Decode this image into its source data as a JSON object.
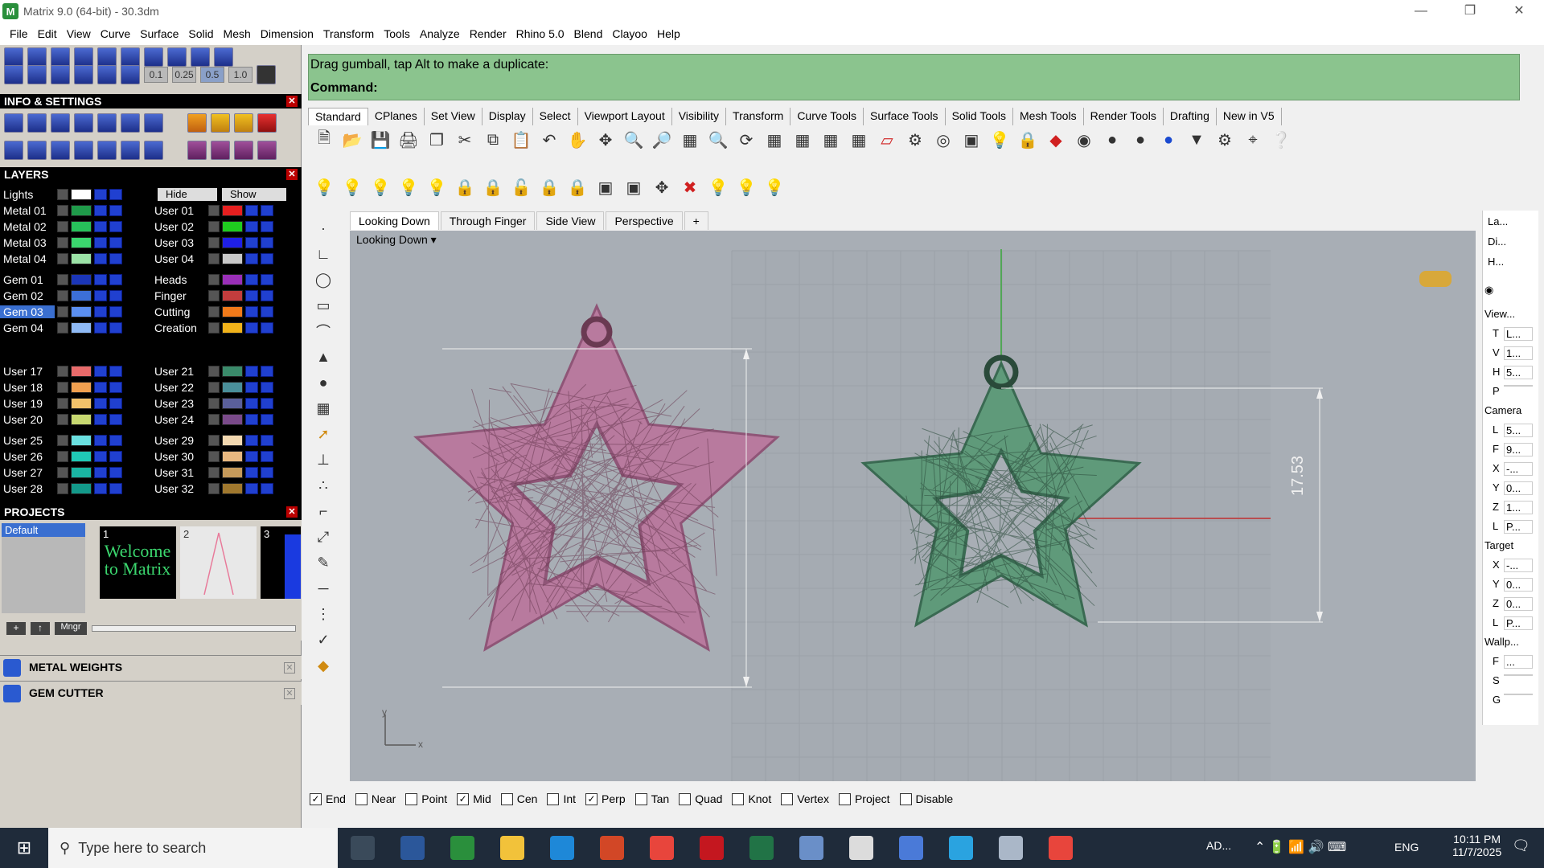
{
  "window": {
    "title": "Matrix 9.0 (64-bit) - 30.3dm"
  },
  "menu": [
    "File",
    "Edit",
    "View",
    "Curve",
    "Surface",
    "Solid",
    "Mesh",
    "Dimension",
    "Transform",
    "Tools",
    "Analyze",
    "Render",
    "Rhino 5.0",
    "Blend",
    "Clayoo",
    "Help"
  ],
  "left_toolbar": {
    "values": [
      "0.1",
      "0.25",
      "0.5",
      "1.0"
    ]
  },
  "info_settings": {
    "title": "INFO & SETTINGS"
  },
  "layers": {
    "title": "LAYERS",
    "lights": "Lights",
    "hide_label": "Hide",
    "show_label": "Show",
    "left_col": [
      {
        "name": "Metal 01",
        "color": "#1f9a4a"
      },
      {
        "name": "Metal 02",
        "color": "#27c05a"
      },
      {
        "name": "Metal 03",
        "color": "#3bd66e"
      },
      {
        "name": "Metal 04",
        "color": "#9be2a6"
      },
      {
        "name": "Gem 01",
        "color": "#1b36b8"
      },
      {
        "name": "Gem 02",
        "color": "#3c6fd7"
      },
      {
        "name": "Gem 03",
        "color": "#5b8ff0",
        "selected": true
      },
      {
        "name": "Gem 04",
        "color": "#8fbaf5"
      },
      {
        "name": "User 17",
        "color": "#e86b6b"
      },
      {
        "name": "User 18",
        "color": "#f0a050"
      },
      {
        "name": "User 19",
        "color": "#f2c26a"
      },
      {
        "name": "User 20",
        "color": "#c7d870"
      },
      {
        "name": "User 25",
        "color": "#6ae0e0"
      },
      {
        "name": "User 26",
        "color": "#20c9b5"
      },
      {
        "name": "User 27",
        "color": "#1ab5a3"
      },
      {
        "name": "User 28",
        "color": "#13998a"
      }
    ],
    "right_col": [
      {
        "name": "User 01",
        "color": "#e61f1f"
      },
      {
        "name": "User 02",
        "color": "#1fcc1f"
      },
      {
        "name": "User 03",
        "color": "#1f1fe6"
      },
      {
        "name": "User 04",
        "color": "#c8c8c8"
      },
      {
        "name": "Heads",
        "color": "#9a2fb8"
      },
      {
        "name": "Finger",
        "color": "#c33d3d"
      },
      {
        "name": "Cutting",
        "color": "#f07a1a"
      },
      {
        "name": "Creation",
        "color": "#f0b21a"
      },
      {
        "name": "User 21",
        "color": "#3a8a6a"
      },
      {
        "name": "User 22",
        "color": "#4a8f9a"
      },
      {
        "name": "User 23",
        "color": "#5a5f9a"
      },
      {
        "name": "User 24",
        "color": "#7a4a8a"
      },
      {
        "name": "User 29",
        "color": "#f2d8b0"
      },
      {
        "name": "User 30",
        "color": "#e8b880"
      },
      {
        "name": "User 31",
        "color": "#c69a5a"
      },
      {
        "name": "User 32",
        "color": "#a0782e"
      }
    ]
  },
  "projects": {
    "title": "PROJECTS",
    "items": [
      "Default"
    ],
    "thumbs": [
      {
        "num": "1",
        "text": "Welcome to Matrix"
      },
      {
        "num": "2",
        "text": ""
      },
      {
        "num": "3",
        "text": ""
      }
    ],
    "mngr": "Mngr"
  },
  "plugins": [
    {
      "name": "METAL WEIGHTS"
    },
    {
      "name": "GEM CUTTER"
    }
  ],
  "command": {
    "prompt": "Drag gumball, tap Alt to make a duplicate:",
    "label": "Command:"
  },
  "toolbar_tabs": [
    "Standard",
    "CPlanes",
    "Set View",
    "Display",
    "Select",
    "Viewport Layout",
    "Visibility",
    "Transform",
    "Curve Tools",
    "Surface Tools",
    "Solid Tools",
    "Mesh Tools",
    "Render Tools",
    "Drafting",
    "New in V5"
  ],
  "viewport_tabs": [
    "Looking Down",
    "Through Finger",
    "Side View",
    "Perspective"
  ],
  "viewport": {
    "label": "Looking Down",
    "dimension": "17.53",
    "axis_x": "x",
    "axis_y": "y"
  },
  "snaps": [
    {
      "label": "End",
      "checked": true
    },
    {
      "label": "Near",
      "checked": false
    },
    {
      "label": "Point",
      "checked": false
    },
    {
      "label": "Mid",
      "checked": true
    },
    {
      "label": "Cen",
      "checked": false
    },
    {
      "label": "Int",
      "checked": false
    },
    {
      "label": "Perp",
      "checked": true
    },
    {
      "label": "Tan",
      "checked": false
    },
    {
      "label": "Quad",
      "checked": false
    },
    {
      "label": "Knot",
      "checked": false
    },
    {
      "label": "Vertex",
      "checked": false
    },
    {
      "label": "Project",
      "checked": false
    },
    {
      "label": "Disable",
      "checked": false
    }
  ],
  "right_panel": {
    "tabs": [
      "La...",
      "Di...",
      "H..."
    ],
    "view_label": "View...",
    "view_rows": [
      {
        "k": "T",
        "v": "L..."
      },
      {
        "k": "V",
        "v": "1..."
      },
      {
        "k": "H",
        "v": "5..."
      },
      {
        "k": "P",
        "v": ""
      }
    ],
    "camera_label": "Camera",
    "camera_rows": [
      {
        "k": "L",
        "v": "5..."
      },
      {
        "k": "F",
        "v": "9..."
      },
      {
        "k": "X",
        "v": "-..."
      },
      {
        "k": "Y",
        "v": "0..."
      },
      {
        "k": "Z",
        "v": "1..."
      },
      {
        "k": "L",
        "v": "P..."
      }
    ],
    "target_label": "Target",
    "target_rows": [
      {
        "k": "X",
        "v": "-..."
      },
      {
        "k": "Y",
        "v": "0..."
      },
      {
        "k": "Z",
        "v": "0..."
      },
      {
        "k": "L",
        "v": "P..."
      }
    ],
    "wallp_label": "Wallp...",
    "wallp_rows": [
      {
        "k": "F",
        "v": "..."
      },
      {
        "k": "S",
        "v": ""
      },
      {
        "k": "G",
        "v": ""
      }
    ]
  },
  "taskbar": {
    "search_placeholder": "Type here to search",
    "tray_app": "AD...",
    "lang": "ENG",
    "time": "10:11 PM",
    "date": "11/7/2025",
    "apps": [
      {
        "name": "task-view",
        "color": "#3a4a5a"
      },
      {
        "name": "word",
        "color": "#2b579a"
      },
      {
        "name": "matrix",
        "color": "#2a8f3c"
      },
      {
        "name": "file-explorer",
        "color": "#f2c23a"
      },
      {
        "name": "edge",
        "color": "#1e88d8"
      },
      {
        "name": "powerpoint",
        "color": "#d24726"
      },
      {
        "name": "chrome",
        "color": "#e8453c"
      },
      {
        "name": "solidworks",
        "color": "#c4171f"
      },
      {
        "name": "excel",
        "color": "#217346"
      },
      {
        "name": "app-window",
        "color": "#6a8fc8"
      },
      {
        "name": "tool-app",
        "color": "#dcdcdc"
      },
      {
        "name": "mail-app",
        "color": "#4a7ad8"
      },
      {
        "name": "telegram",
        "color": "#2aa3e0"
      },
      {
        "name": "printer-app",
        "color": "#aab7c8"
      },
      {
        "name": "chrome-2",
        "color": "#e8453c"
      }
    ]
  }
}
